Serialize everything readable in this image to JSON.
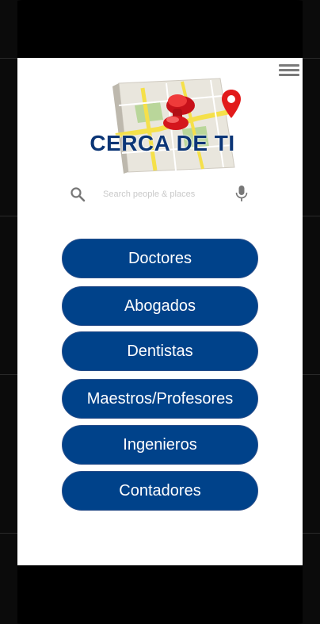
{
  "header": {
    "menu_icon": "hamburger-menu-icon",
    "logo_title": "CERCA DE TI",
    "logo_icon": "map-pin-icon"
  },
  "search": {
    "placeholder": "Search people & places",
    "value": "",
    "search_icon": "search-icon",
    "mic_icon": "microphone-icon"
  },
  "categories": [
    {
      "label": "Doctores"
    },
    {
      "label": "Abogados"
    },
    {
      "label": "Dentistas"
    },
    {
      "label": "Maestros/Profesores"
    },
    {
      "label": "Ingenieros"
    },
    {
      "label": "Contadores"
    }
  ],
  "colors": {
    "button_bg": "#00428a",
    "title": "#0b3576",
    "pin_red": "#e21b1b",
    "map_yellow": "#f5e04a"
  }
}
